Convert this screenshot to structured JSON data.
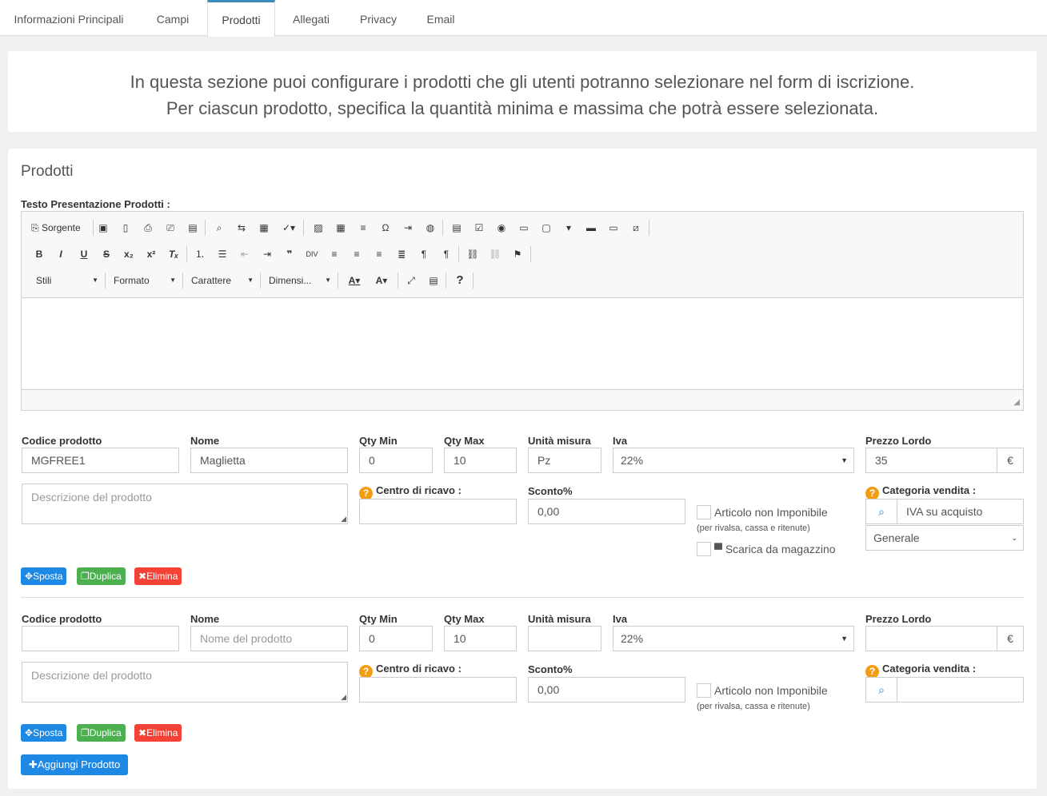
{
  "tabs": [
    "Informazioni Principali",
    "Campi",
    "Prodotti",
    "Allegati",
    "Privacy",
    "Email"
  ],
  "info": {
    "line1": "In questa sezione puoi configurare i prodotti che gli utenti potranno selezionare nel form di iscrizione.",
    "line2": "Per ciascun prodotto, specifica la quantità minima e massima che potrà essere selezionata."
  },
  "panel": {
    "title": "Prodotti",
    "editor_label": "Testo Presentazione Prodotti :",
    "toolbar": {
      "source": "Sorgente",
      "combos": [
        "Stili",
        "Formato",
        "Carattere",
        "Dimensi..."
      ],
      "icons_row1": [
        "save-icon",
        "new-page-icon",
        "preview-icon",
        "print-icon",
        "templates-icon",
        "find-icon",
        "replace-icon",
        "select-all-icon",
        "spellcheck-icon",
        "image-icon",
        "table-icon",
        "horizontal-rule-icon",
        "special-char-icon",
        "iframe-icon",
        "globe-icon",
        "form-icon",
        "checkbox-icon",
        "radio-icon",
        "textfield-icon",
        "textarea-icon",
        "select-icon",
        "button-icon",
        "imagebutton-icon",
        "hiddenfield-icon"
      ],
      "icons_row2": [
        "bold-icon",
        "italic-icon",
        "underline-icon",
        "strike-icon",
        "subscript-icon",
        "superscript-icon",
        "remove-format-icon",
        "numbered-list-icon",
        "bulleted-list-icon",
        "outdent-icon",
        "indent-icon",
        "blockquote-icon",
        "div-icon",
        "align-left-icon",
        "align-center-icon",
        "align-right-icon",
        "justify-icon",
        "ltr-icon",
        "rtl-icon",
        "link-icon",
        "unlink-icon",
        "anchor-icon"
      ],
      "icons_row3": [
        "text-color-icon",
        "bg-color-icon",
        "maximize-icon",
        "show-blocks-icon",
        "help-icon"
      ]
    }
  },
  "labels": {
    "codice": "Codice prodotto",
    "nome": "Nome",
    "qtymin": "Qty Min",
    "qtymax": "Qty Max",
    "unita": "Unità misura",
    "iva": "Iva",
    "prezzo": "Prezzo Lordo",
    "centro": "Centro di ricavo :",
    "sconto": "Sconto%",
    "categoria": "Categoria vendita :",
    "articolo": "Articolo non Imponibile",
    "articolo_note": "(per rivalsa, cassa e ritenute)",
    "scarica": "Scarica da magazzino",
    "currency": "€",
    "desc_placeholder": "Descrizione del prodotto",
    "nome_placeholder": "Nome del prodotto",
    "sposta": "Sposta",
    "duplica": "Duplica",
    "elimina": "Elimina",
    "aggiungi": "Aggiungi Prodotto"
  },
  "products": [
    {
      "codice": "MGFREE1",
      "nome": "Maglietta",
      "qtymin": "0",
      "qtymax": "10",
      "unita": "Pz",
      "iva": "22%",
      "prezzo": "35",
      "sconto": "0,00",
      "categoria": "IVA su acquisto",
      "magazzino": "Generale"
    },
    {
      "codice": "",
      "nome": "",
      "qtymin": "0",
      "qtymax": "10",
      "unita": "",
      "iva": "22%",
      "prezzo": "",
      "sconto": "0,00",
      "categoria": ""
    }
  ]
}
